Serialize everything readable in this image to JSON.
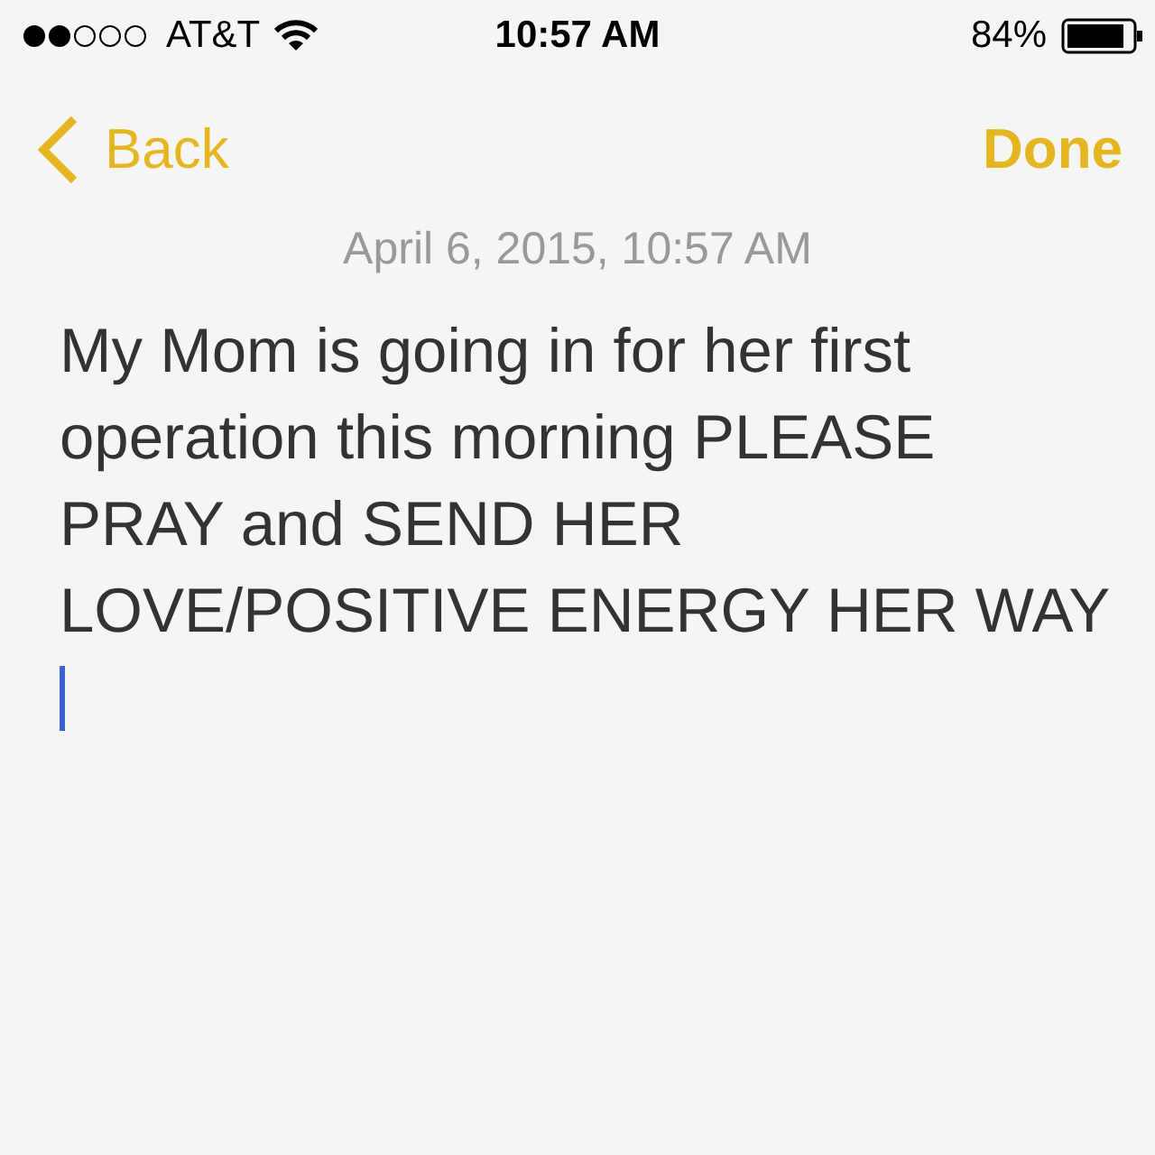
{
  "status_bar": {
    "carrier": "AT&T",
    "time": "10:57 AM",
    "battery": "84%"
  },
  "nav": {
    "back": "Back",
    "done": "Done"
  },
  "note": {
    "date": "April 6, 2015, 10:57 AM",
    "body": "My Mom is going in for her first operation this morning PLEASE PRAY and SEND HER LOVE/POSITIVE ENERGY HER WAY"
  }
}
